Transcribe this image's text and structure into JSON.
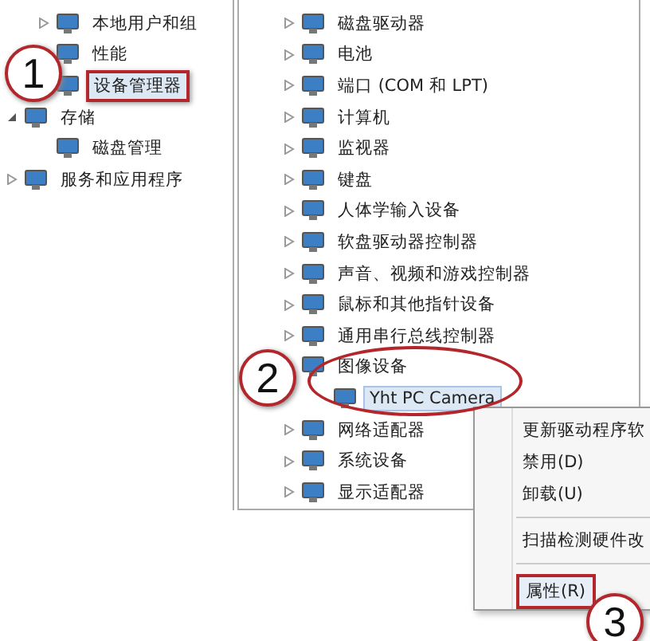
{
  "left_tree": {
    "items": [
      {
        "children": [
          {
            "label": "本地用户和组",
            "expanded": false,
            "selected": false,
            "marked": false
          },
          {
            "label": "性能",
            "selected": false,
            "marked": false
          },
          {
            "label": "设备管理器",
            "selected": true,
            "marked": true
          }
        ]
      },
      {
        "label": "存储",
        "expanded": true,
        "selected": false,
        "marked": false,
        "children": [
          {
            "label": "磁盘管理",
            "selected": false,
            "marked": false
          }
        ]
      },
      {
        "label": "服务和应用程序",
        "expanded": false,
        "selected": false,
        "marked": false
      }
    ]
  },
  "device_tree": {
    "items": [
      {
        "label": "磁盘驱动器",
        "expanded": false,
        "selected": false
      },
      {
        "label": "电池",
        "expanded": false,
        "selected": false
      },
      {
        "label": "端口 (COM 和 LPT)",
        "expanded": false,
        "selected": false
      },
      {
        "label": "计算机",
        "expanded": false,
        "selected": false
      },
      {
        "label": "监视器",
        "expanded": false,
        "selected": false
      },
      {
        "label": "键盘",
        "expanded": false,
        "selected": false
      },
      {
        "label": "人体学输入设备",
        "expanded": false,
        "selected": false
      },
      {
        "label": "软盘驱动器控制器",
        "expanded": false,
        "selected": false
      },
      {
        "label": "声音、视频和游戏控制器",
        "expanded": false,
        "selected": false
      },
      {
        "label": "鼠标和其他指针设备",
        "expanded": false,
        "selected": false
      },
      {
        "label": "通用串行总线控制器",
        "expanded": false,
        "selected": false
      },
      {
        "label": "图像设备",
        "expanded": true,
        "selected": false,
        "children": [
          {
            "label": "Yht PC Camera",
            "selected": true
          }
        ]
      },
      {
        "label": "网络适配器",
        "expanded": false,
        "selected": false
      },
      {
        "label": "系统设备",
        "expanded": false,
        "selected": false
      },
      {
        "label": "显示适配器",
        "expanded": false,
        "selected": false
      }
    ]
  },
  "context_menu": {
    "items": [
      {
        "kind": "item",
        "label": "更新驱动程序软",
        "marked": false
      },
      {
        "kind": "item",
        "label": "禁用(D)",
        "marked": false
      },
      {
        "kind": "item",
        "label": "卸载(U)",
        "marked": false
      },
      {
        "kind": "separator"
      },
      {
        "kind": "item",
        "label": "扫描检测硬件改",
        "marked": false
      },
      {
        "kind": "separator"
      },
      {
        "kind": "item",
        "label": "属性(R)",
        "marked": true
      }
    ]
  },
  "step_markers": [
    {
      "number": "1"
    },
    {
      "number": "2"
    },
    {
      "number": "3"
    }
  ]
}
